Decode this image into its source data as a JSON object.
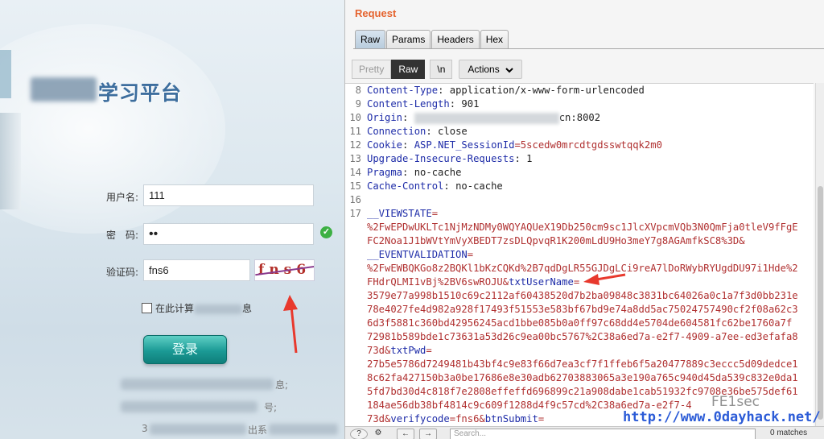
{
  "login": {
    "platform_title": "学习平台",
    "username_label": "用户名:",
    "username_value": "111",
    "password_label": "密　码:",
    "password_value": "••",
    "captcha_label": "验证码:",
    "captcha_value": "fns6",
    "captcha_image_text": "fns6",
    "remember_label": "在此计算",
    "remember_suffix": "息",
    "login_button": "登录",
    "footer_lines": [
      "息;",
      "号;",
      "3",
      "出系"
    ],
    "password_status_icon": "check-circle-icon"
  },
  "burp": {
    "section_title": "Request",
    "view_tabs": [
      "Raw",
      "Params",
      "Headers",
      "Hex"
    ],
    "active_view_tab": "Raw",
    "toolbar": {
      "pretty": "Pretty",
      "raw": "Raw",
      "newline": "\\n",
      "actions": "Actions"
    },
    "header_lines": [
      {
        "num": "8",
        "key": "Content-Type",
        "value": " application/x-www-form-urlencoded"
      },
      {
        "num": "9",
        "key": "Content-Length",
        "value": " 901"
      },
      {
        "num": "10",
        "key": "Origin",
        "value": "cn:8002"
      },
      {
        "num": "11",
        "key": "Connection",
        "value": " close"
      },
      {
        "num": "12",
        "key": "Cookie",
        "value": " ",
        "cookie_name": "ASP.NET_SessionId",
        "cookie_value": "=5scedw0mrcdtgdsswtqqk2m0"
      },
      {
        "num": "13",
        "key": "Upgrade-Insecure-Requests",
        "value": " 1"
      },
      {
        "num": "14",
        "key": "Pragma",
        "value": " no-cache"
      },
      {
        "num": "15",
        "key": "Cache-Control",
        "value": " no-cache"
      },
      {
        "num": "16",
        "key": "",
        "value": ""
      },
      {
        "num": "17",
        "key": "",
        "value": ""
      }
    ],
    "body_rows": [
      {
        "param": "__VIEWSTATE",
        "rest": "="
      },
      {
        "param": "",
        "rest": "%2FwEPDwUKLTc1NjMzNDMy0WQYAQUeX19Db250cm9sc1JlcXVpcmVQb3N0QmFja0tleV9fFgE"
      },
      {
        "param": "",
        "rest": "FC2Noa1J1bWVtYmVyXBEDT7zsDLQpvqR1K200mLdU9Ho3meY7g8AGAmfkSC8%3D&"
      },
      {
        "param": "__EVENTVALIDATION",
        "rest": "="
      },
      {
        "param": "",
        "rest": "%2FwEWBQKGo8z2BQKl1bKzCQKd%2B7qdDgLR55GJDgLCi9reA7lDoRWybRYUgdDU97i1Hde%2"
      },
      {
        "param": "",
        "rest": "FHdrQLMI1vBj%2BV6swROJU&",
        "tail_param": "txtUserName",
        "tail_rest": "="
      },
      {
        "param": "",
        "rest": "3579e77a998b1510c69c2112af60438520d7b2ba09848c3831bc64026a0c1a7f3d0bb231e"
      },
      {
        "param": "",
        "rest": "78e4027fe4d982a928f17493f51553e583bf67bd9e74a8dd5ac75024757490cf2f08a62c3"
      },
      {
        "param": "",
        "rest": "6d3f5881c360bd42956245acd1bbe085b0a0ff97c68dd4e5704de604581fc62be1760a7f"
      },
      {
        "param": "",
        "rest": "72981b589bde1c73631a53d26c9ea00bc5767%2C38a6ed7a-e2f7-4909-a7ee-ed3efafa8"
      },
      {
        "param": "",
        "rest": "73d&",
        "tail_param": "txtPwd",
        "tail_rest": "="
      },
      {
        "param": "",
        "rest": "27b5e5786d7249481b43bf4c9e83f66d7ea3cf7f1ffeb6f5a20477889c3eccc5d09dedce1"
      },
      {
        "param": "",
        "rest": "8c62fa427150b3a0be17686e8e30adb62703883065a3e190a765c940d45da539c832e0da1"
      },
      {
        "param": "",
        "rest": "5fd7bd30d4c818f7e2808effeffd696899c21a908dabe1cab51932fc9708e36be575def61"
      },
      {
        "param": "",
        "rest": "184ae56db38bf4814c9c609f1288d4f9c57cd%2C38a6ed7a-e2f7-4"
      },
      {
        "param": "",
        "rest": "73d&",
        "tail_param": "verifycode",
        "tail_rest": "=fns6&",
        "tail_param2": "btnSubmit",
        "tail_rest2": "="
      }
    ],
    "search_placeholder": "Search...",
    "match_count": "0 matches",
    "bottom_icons": [
      "help-icon",
      "settings-icon",
      "back-arrow-icon",
      "forward-arrow-icon"
    ]
  },
  "watermark": {
    "brand": "FE1sec",
    "url": "http://www.0dayhack.net/"
  },
  "colors": {
    "burp_accent": "#e5632e",
    "header_key": "#1e2ca8",
    "body_value": "#b03030",
    "login_button": "#1b9a95",
    "arrow": "#e8392d"
  }
}
